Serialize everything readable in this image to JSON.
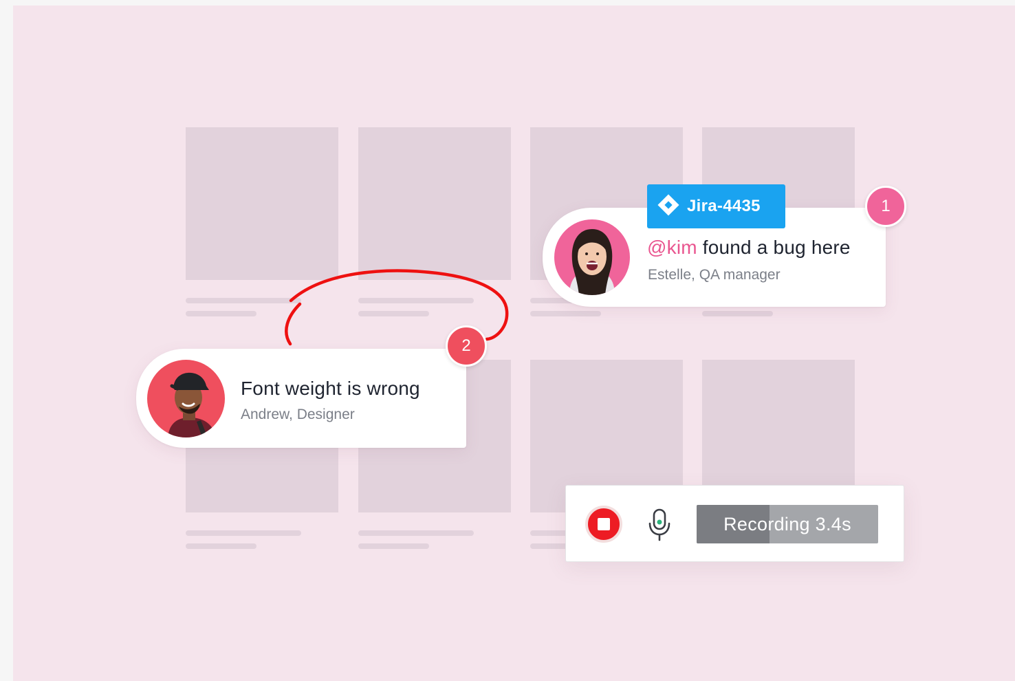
{
  "comments": [
    {
      "number": "1",
      "mention": "@kim",
      "text": " found a bug here",
      "author": "Estelle, QA manager",
      "jira_label": "Jira-4435"
    },
    {
      "number": "2",
      "text": "Font weight is wrong",
      "author": "Andrew, Designer"
    }
  ],
  "recorder": {
    "label": "Recording 3.4s",
    "progress_fraction": 0.4
  },
  "colors": {
    "background": "#f5e4ec",
    "placeholder": "#e2d2dc",
    "badge_1": "#f0649a",
    "badge_2": "#ef4f5e",
    "mention": "#e9558f",
    "jira": "#1aa3f0",
    "annotation_stroke": "#ee1111",
    "stop": "#ed1c24"
  },
  "icons": [
    "jira-icon",
    "stop-icon",
    "microphone-icon"
  ]
}
